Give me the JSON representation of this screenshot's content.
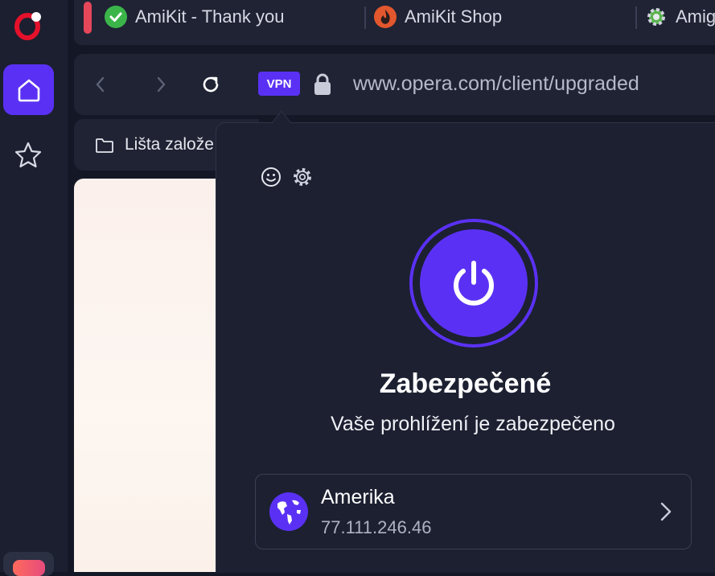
{
  "tabs": [
    {
      "title": "AmiKit - Thank you",
      "favicon": "green-check-icon"
    },
    {
      "title": "AmiKit Shop",
      "favicon": "amikit-flame-icon"
    },
    {
      "title": "Amig",
      "favicon": "amikit-gear-icon"
    }
  ],
  "address_bar": {
    "vpn_label": "VPN",
    "url": "www.opera.com/client/upgraded"
  },
  "bookmarks": {
    "folder_label": "Lišta založe"
  },
  "vpn_popup": {
    "status_title": "Zabezpečené",
    "status_subtitle": "Vaše prohlížení je zabezpečeno",
    "location": {
      "name": "Amerika",
      "ip": "77.111.246.46"
    }
  },
  "colors": {
    "accent": "#5a31f4",
    "background": "#141826",
    "panel": "#1c2031",
    "tab_indicator": "#e5475a"
  }
}
